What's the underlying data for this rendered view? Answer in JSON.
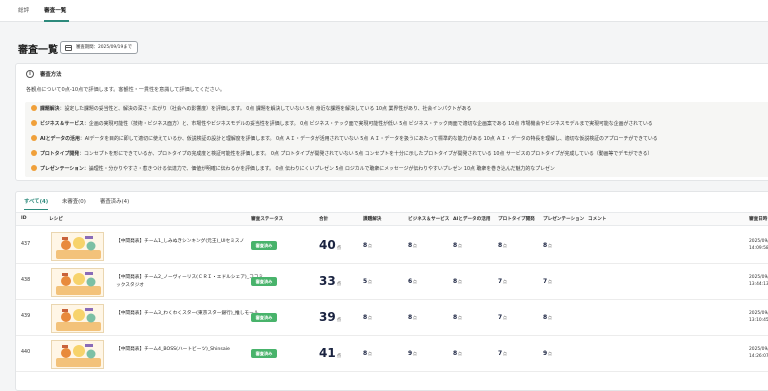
{
  "top_tabs": [
    "総評",
    "審査一覧"
  ],
  "active_top_tab": 1,
  "page_title": "審査一覧",
  "period_badge": "審査期間：2025/09/19まで",
  "method": {
    "title": "審査方法",
    "description": "各観点について0点-10点で評価します。客観性・一貫性を意識して評価してください。",
    "criteria": [
      {
        "name": "課題解決",
        "text": "：設定した課題の妥当性と、解決の深さ・広がり（社会への影響度）を評価します。 0点 課題を解決していない 5点 身近な課題を解決している 10点 業界性があり、社会インパクトがある"
      },
      {
        "name": "ビジネス＆サービス",
        "text": "：企画の実現可能性（技術・ビジネス面方）と、市場性やビジネスモデルの妥当性を評価します。 0点 ビジネス・テック面で実現可能性が低い 5点 ビジネス・テック両面で適切な企画案である 10点 市場機会やビジネスモデルまで実現可能な企画がされている"
      },
      {
        "name": "AIとデータの活用",
        "text": "：AIデータを目的に即して適切に使えているか、仮説検証の設計と理解度を評価します。 0点 ＡＩ・データが活用されていない 5点 ＡＩ・データを扱うにあたって標準的な能力がある 10点 ＡＩ・データの特長を理解し、適切な仮説検証のアプローチができている"
      },
      {
        "name": "プロトタイプ開発",
        "text": "：コンセプトを形にできているか、プロトタイプの完成度と検証可能性を評価します。 0点 プロトタイプが開発されていない 5点 コンセプトを十分に示したプロトタイプが開発されている 10点 サービスのプロトタイプが完成している（動画等でデモができる）"
      },
      {
        "name": "プレゼンテーション",
        "text": "：論理性・分かりやすさ・惹きつける伝達力で、価値が明確に伝わるかを評価します。 0点 伝わりにくいプレゼン 5点 ロジカルで聴衆にメッセージが伝わりやすいプレゼン 10点 聴衆を巻き込んだ魅力的なプレゼン"
      }
    ]
  },
  "result_tabs": [
    "すべて(4)",
    "未審査(0)",
    "審査済み(4)"
  ],
  "active_result_tab": 0,
  "columns": [
    "ID",
    "レシピ",
    "審査ステータス",
    "合計",
    "課題解決",
    "ビジネス＆サービス",
    "AIとデータの活用",
    "プロトタイプ開発",
    "プレゼンテーション",
    "コメント",
    "審査日時"
  ],
  "score_unit": "点",
  "rows": [
    {
      "id": "437",
      "name": "【中間発表】チーム1_しみぬきシンキング(元王)_UIセミスノ",
      "status": "審査済み",
      "total": 40,
      "scores": [
        8,
        8,
        8,
        8,
        8
      ],
      "date": "2025/09/… 14:09:58"
    },
    {
      "id": "438",
      "name": "【中間発表】チーム2_ノーヴィーリス(ＣＲＩ・エドルシェア)_ココミックスタジオ",
      "status": "審査済み",
      "total": 33,
      "scores": [
        5,
        6,
        8,
        7,
        7
      ],
      "date": "2025/09/… 13:44:13"
    },
    {
      "id": "439",
      "name": "【中間発表】チーム3_わくわくスター(東京スター銀行)_推しモール",
      "status": "審査済み",
      "total": 39,
      "scores": [
        8,
        8,
        8,
        7,
        8
      ],
      "date": "2025/09/… 13:10:45"
    },
    {
      "id": "440",
      "name": "【中間発表】チーム4_BOSS(ハートビーツ)_Shinsaie",
      "status": "審査済み",
      "total": 41,
      "scores": [
        8,
        9,
        8,
        7,
        9
      ],
      "date": "2025/09/… 14:26:07"
    }
  ],
  "colors": {
    "accent": "#2d8a7c",
    "status_green": "#48b36b",
    "criteria_dot": "#f0a03a"
  }
}
